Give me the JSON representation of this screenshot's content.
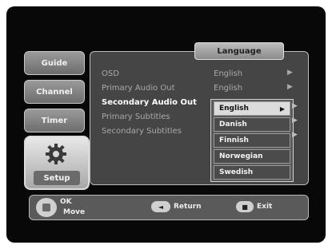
{
  "sidebar": {
    "items": [
      {
        "label": "Guide"
      },
      {
        "label": "Channel"
      },
      {
        "label": "Timer"
      },
      {
        "label": "Setup"
      }
    ]
  },
  "panel": {
    "title": "Language",
    "rows": [
      {
        "label": "OSD",
        "value": "English"
      },
      {
        "label": "Primary Audio Out",
        "value": "English"
      },
      {
        "label": "Secondary Audio Out",
        "value": ""
      },
      {
        "label": "Primary Subtitles",
        "value": ""
      },
      {
        "label": "Secondary Subtitles",
        "value": ""
      }
    ],
    "dropdown": {
      "options": [
        "English",
        "Danish",
        "Finnish",
        "Norwegian",
        "Swedish"
      ],
      "selected": "English"
    }
  },
  "help": {
    "ok": "OK",
    "move": "Move",
    "return_label": "Return",
    "exit_label": "Exit"
  },
  "icons": {
    "nav": "directional-pad-icon",
    "settings": "gear-icon",
    "arrow": "right-arrow-icon"
  }
}
